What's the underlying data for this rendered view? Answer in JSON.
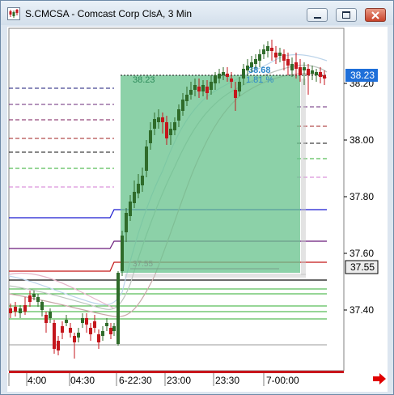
{
  "window": {
    "title": "S.CMCSA - Comcast Corp ClsA, 3 Min",
    "controls": [
      "minimize",
      "restore",
      "close"
    ]
  },
  "price_axis": {
    "ticks": [
      "38.20",
      "38.00",
      "37.80",
      "37.60",
      "37.40"
    ],
    "last_price_label": "38.23",
    "marker_price_label": "37.55"
  },
  "time_axis": {
    "ticks": [
      "4:00",
      "04:30",
      "6-22:30",
      "23:00",
      "23:30",
      "7-00:00"
    ]
  },
  "measure_box": {
    "top_price": "38.23",
    "end_price": "38.68",
    "percent": "1.81 %",
    "bottom_price": "37.55"
  },
  "colors": {
    "up_candle": "#2f6b2a",
    "down_candle": "#c4161c",
    "measure_fill": "#6cc48f",
    "last_price_badge": "#1e6fd9",
    "scroll_arrow": "#e00000"
  },
  "icons": {
    "app": "chart-app-icon",
    "scroll_right": "red-arrow-right-icon"
  }
}
